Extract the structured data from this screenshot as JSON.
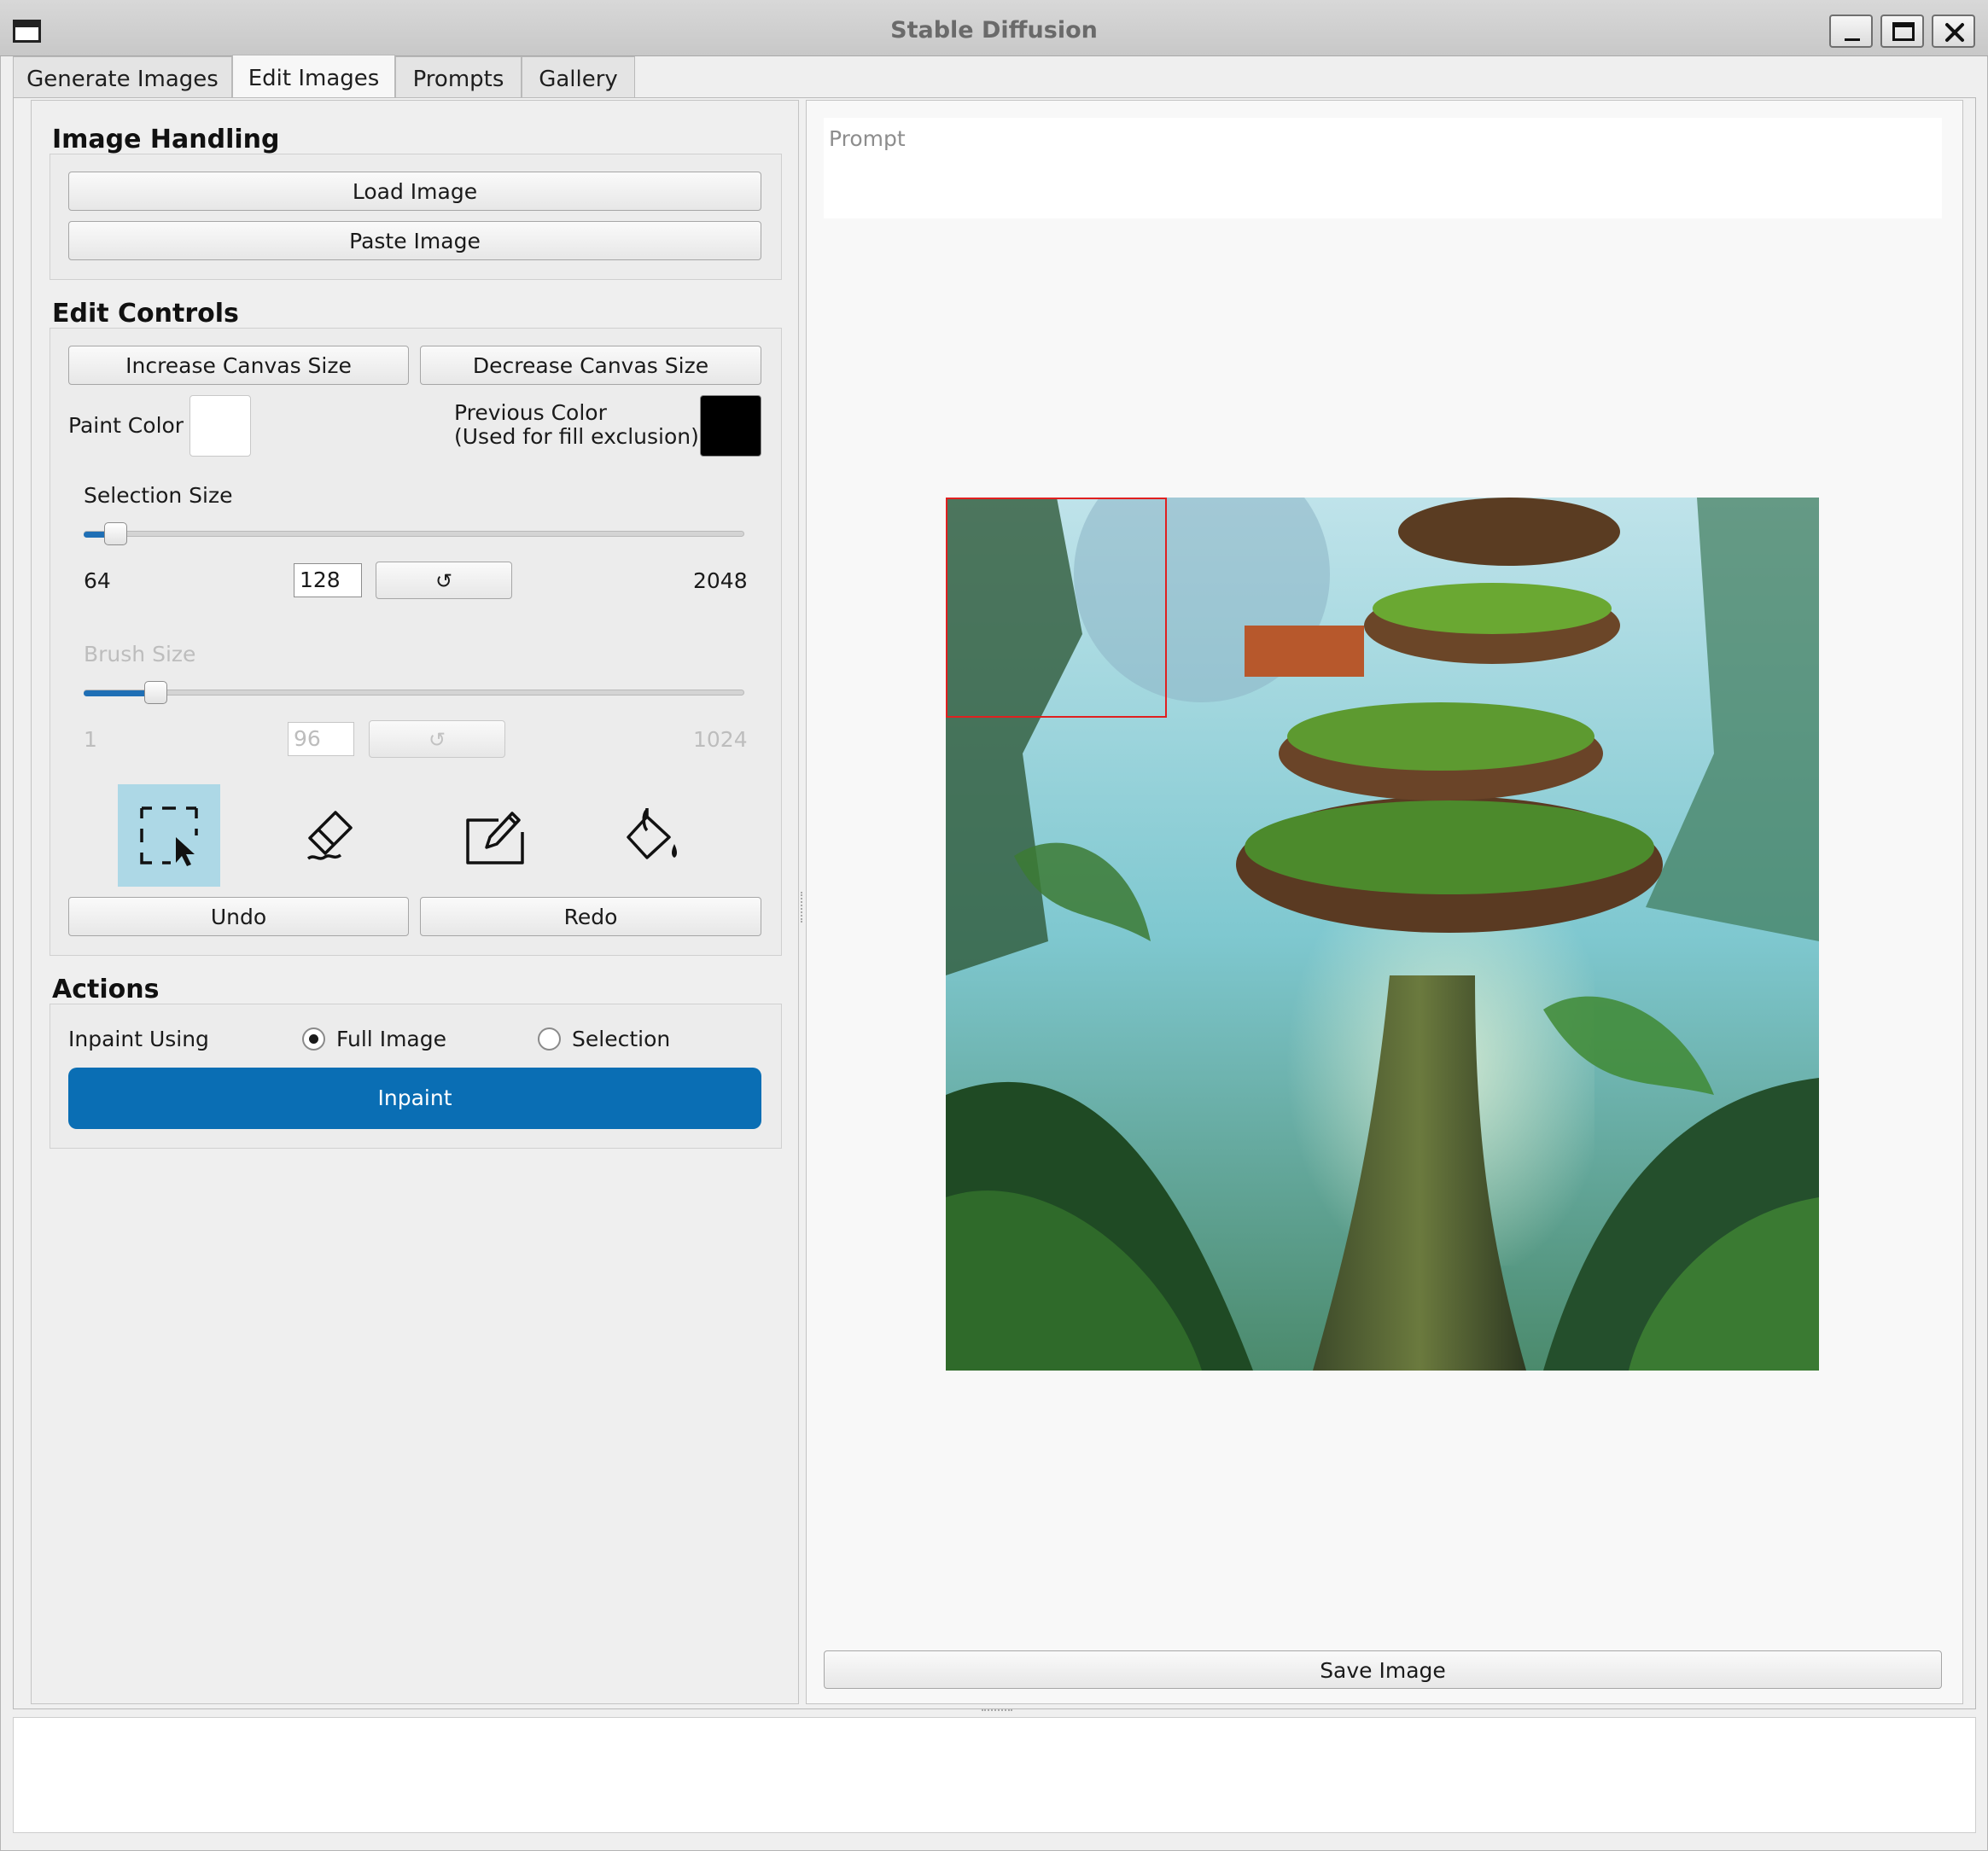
{
  "window": {
    "title": "Stable Diffusion",
    "controls": [
      "minimize-icon",
      "maximize-icon",
      "close-icon"
    ]
  },
  "tabs": [
    {
      "label": "Generate Images",
      "active": false
    },
    {
      "label": "Edit Images",
      "active": true
    },
    {
      "label": "Prompts",
      "active": false
    },
    {
      "label": "Gallery",
      "active": false
    }
  ],
  "image_handling": {
    "title": "Image Handling",
    "load_label": "Load Image",
    "paste_label": "Paste Image"
  },
  "edit_controls": {
    "title": "Edit Controls",
    "increase_label": "Increase Canvas Size",
    "decrease_label": "Decrease Canvas Size",
    "paint_color_label": "Paint Color",
    "paint_color": "#ffffff",
    "previous_color_line1": "Previous Color",
    "previous_color_line2": "(Used for fill exclusion)",
    "previous_color": "#000000",
    "selection_size": {
      "label": "Selection Size",
      "min": "64",
      "max": "2048",
      "value": "128",
      "reset_glyph": "↺"
    },
    "brush_size": {
      "label": "Brush Size",
      "min": "1",
      "max": "1024",
      "value": "96",
      "reset_glyph": "↺",
      "enabled": false
    },
    "tools": [
      {
        "name": "selection-tool",
        "icon": "selection-cursor-icon",
        "active": true
      },
      {
        "name": "eraser-tool",
        "icon": "eraser-icon",
        "active": false
      },
      {
        "name": "pencil-tool",
        "icon": "pencil-icon",
        "active": false
      },
      {
        "name": "fill-tool",
        "icon": "paint-bucket-icon",
        "active": false
      }
    ],
    "undo_label": "Undo",
    "redo_label": "Redo"
  },
  "actions": {
    "title": "Actions",
    "inpaint_using_label": "Inpaint Using",
    "options": [
      {
        "label": "Full Image",
        "checked": true
      },
      {
        "label": "Selection",
        "checked": false
      }
    ],
    "inpaint_label": "Inpaint"
  },
  "right": {
    "prompt_placeholder": "Prompt",
    "save_label": "Save Image"
  },
  "colors": {
    "accent": "#0a6eb4",
    "active_tool_bg": "#add8e6",
    "selection_outline": "#e02020"
  }
}
